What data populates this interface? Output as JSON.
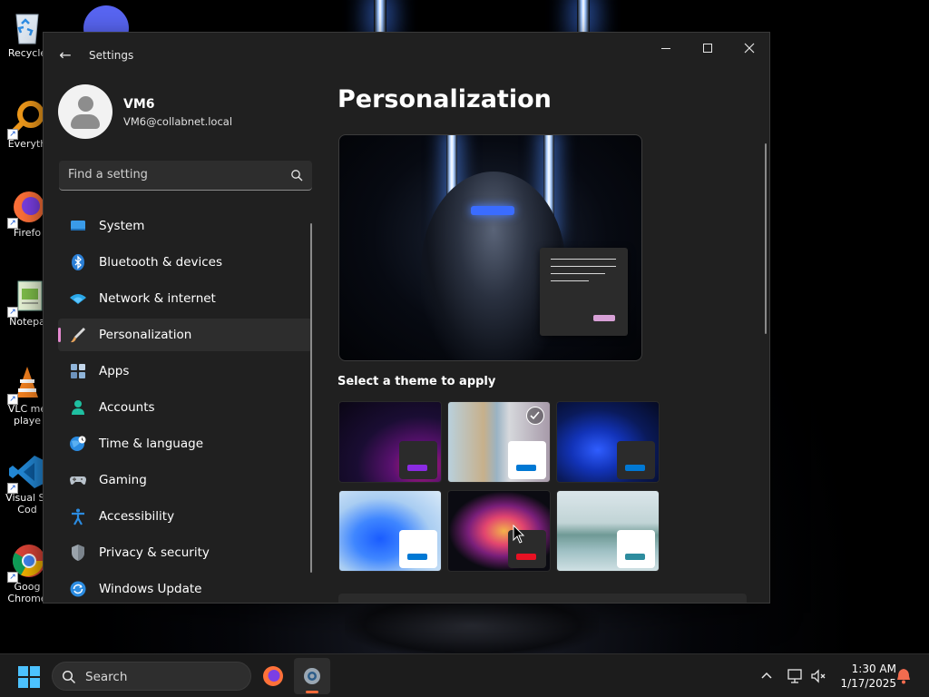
{
  "desktop": {
    "icons": [
      {
        "label": "Recycle",
        "icon": "recycle-bin-icon"
      },
      {
        "label": "Everyth",
        "icon": "everything-search-icon"
      },
      {
        "label": "Firefo",
        "icon": "firefox-icon"
      },
      {
        "label": "Notepa",
        "icon": "notepad-icon"
      },
      {
        "label": "VLC me",
        "label2": "playe",
        "icon": "vlc-icon"
      },
      {
        "label": "Visual St",
        "label2": "Cod",
        "icon": "vscode-icon"
      },
      {
        "label": "Goog",
        "label2": "Chrome",
        "icon": "chrome-icon"
      }
    ],
    "extra_icon": "discord-icon"
  },
  "window": {
    "title": "Settings",
    "back_icon": "back-arrow-icon",
    "controls": [
      "minimize",
      "maximize",
      "close"
    ]
  },
  "profile": {
    "name": "VM6",
    "email": "VM6@collabnet.local"
  },
  "search": {
    "placeholder": "Find a setting",
    "value": ""
  },
  "nav": {
    "items": [
      {
        "label": "System",
        "icon": "system-display-icon",
        "active": false
      },
      {
        "label": "Bluetooth & devices",
        "icon": "bluetooth-icon",
        "active": false
      },
      {
        "label": "Network & internet",
        "icon": "wifi-icon",
        "active": false
      },
      {
        "label": "Personalization",
        "icon": "paintbrush-icon",
        "active": true
      },
      {
        "label": "Apps",
        "icon": "apps-icon",
        "active": false
      },
      {
        "label": "Accounts",
        "icon": "accounts-icon",
        "active": false
      },
      {
        "label": "Time & language",
        "icon": "globe-clock-icon",
        "active": false
      },
      {
        "label": "Gaming",
        "icon": "gamepad-icon",
        "active": false
      },
      {
        "label": "Accessibility",
        "icon": "accessibility-icon",
        "active": false
      },
      {
        "label": "Privacy & security",
        "icon": "shield-icon",
        "active": false
      },
      {
        "label": "Windows Update",
        "icon": "windows-update-icon",
        "active": false
      }
    ]
  },
  "main": {
    "title": "Personalization",
    "themes_heading": "Select a theme to apply",
    "themes": [
      {
        "name": "dark-purple-glow",
        "accent": "#8a2be2",
        "chip": "#2b2b2b",
        "selected": false
      },
      {
        "name": "flowers-landscape",
        "accent": "#0078d4",
        "chip": "#ffffff",
        "selected": true
      },
      {
        "name": "windows-bloom-dark",
        "accent": "#0078d4",
        "chip": "#2b2b2b",
        "selected": false
      },
      {
        "name": "windows-bloom-light",
        "accent": "#0078d4",
        "chip": "#ffffff",
        "selected": false
      },
      {
        "name": "glow-flower-dark",
        "accent": "#e81123",
        "chip": "#2b2b2b",
        "selected": false
      },
      {
        "name": "lake-landscape",
        "accent": "#2d8c9e",
        "chip": "#ffffff",
        "selected": false
      }
    ]
  },
  "taskbar": {
    "search_label": "Search",
    "apps": [
      {
        "name": "firefox",
        "icon": "firefox-icon",
        "active": false
      },
      {
        "name": "settings",
        "icon": "settings-gear-icon",
        "active": true
      }
    ],
    "time": "1:30 AM",
    "date": "1/17/2025"
  },
  "colors": {
    "accent_indicator": "#e58ad0",
    "window_bg": "#202020",
    "start_blue": "#4cc2ff"
  }
}
